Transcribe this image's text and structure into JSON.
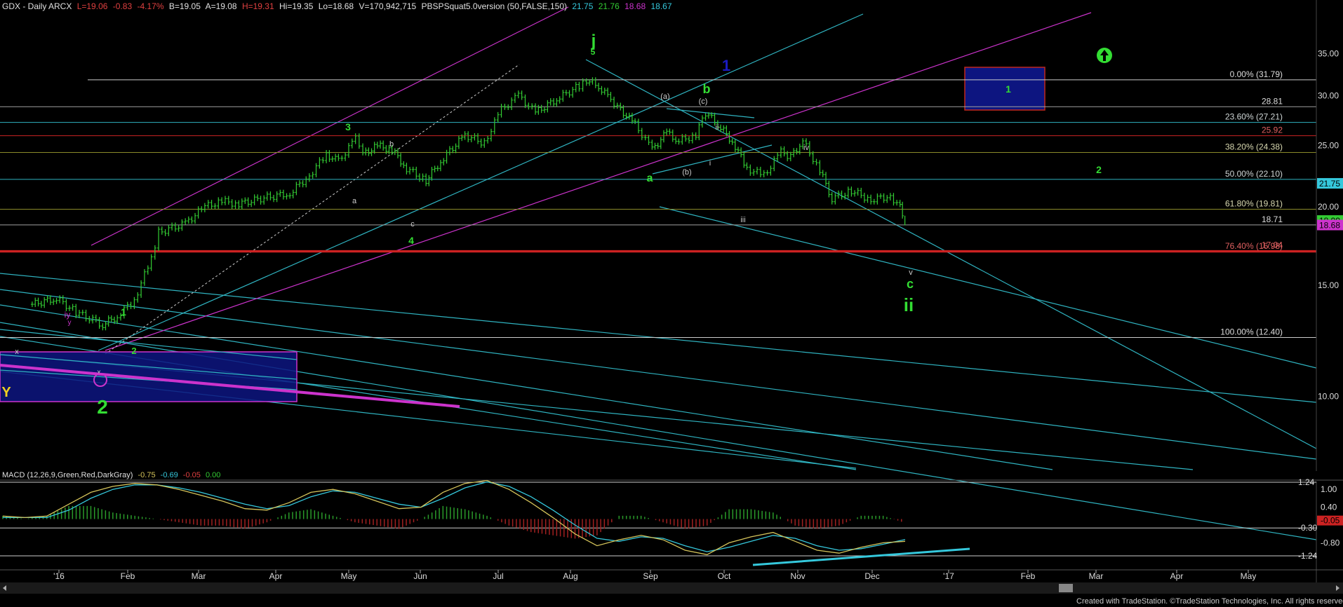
{
  "header": {
    "symbol": "GDX - Daily  ARCX",
    "last": "L=19.06",
    "change": "-0.83",
    "pct": "-4.17%",
    "bid": "B=19.05",
    "ask": "A=19.08",
    "hi": "H=19.31",
    "hi2": "Hi=19.35",
    "lo": "Lo=18.68",
    "vol": "V=170,942,715",
    "study": "PBSPSquat5.0version (50,FALSE,150)",
    "s1": "21.75",
    "s2": "21.76",
    "s3": "18.68",
    "s4": "18.67"
  },
  "macd_header": {
    "name": "MACD (12,26,9,Green,Red,DarkGray)",
    "v1": "-0.75",
    "v2": "-0.69",
    "v3": "-0.05",
    "v4": "0.00"
  },
  "footer": "Created with TradeStation. ©TradeStation Technologies, Inc. All rights reserved.",
  "colors": {
    "background": "#000000",
    "bars": "#33cc33",
    "cyan": "#2fb3c0",
    "magenta": "#cc33cc",
    "red": "#cc2222",
    "olive": "#8a8a2a",
    "box_fill": "#0d1580",
    "box_edge": "#c0281e",
    "wave_green": "#33dd33",
    "macd_yellow": "#d4c35a",
    "macd_cyan": "#35c8dc"
  },
  "chart_data": {
    "type": "line",
    "title": "GDX - Daily",
    "price_axis": {
      "ticks": [
        10.0,
        15.0,
        20.0,
        25.0,
        30.0,
        35.0
      ],
      "tick_labels": [
        "10.00",
        "15.00",
        "20.00",
        "25.00",
        "30.00",
        "35.00"
      ],
      "scale": "log"
    },
    "x_axis_labels": [
      "'16",
      "Feb",
      "Mar",
      "Apr",
      "May",
      "Jun",
      "Jul",
      "Aug",
      "Sep",
      "Oct",
      "Nov",
      "Dec",
      "'17",
      "Feb",
      "Mar",
      "Apr",
      "May"
    ],
    "price_markers": [
      {
        "label": "21.75",
        "value": 21.75,
        "color": "#35c8dc"
      },
      {
        "label": "18.99",
        "value": 18.99,
        "color": "#33cc33"
      },
      {
        "label": "18.68",
        "value": 18.68,
        "color": "#cc33cc"
      }
    ],
    "fib_levels": [
      {
        "label": "0.00% (31.79)",
        "value": 31.79,
        "color": "#cccccc"
      },
      {
        "label": "28.81",
        "value": 28.81,
        "color": "#a0a0a0"
      },
      {
        "label": "23.60% (27.21)",
        "value": 27.21,
        "color": "#2fb3c0"
      },
      {
        "label": "25.92",
        "value": 25.92,
        "color": "#cc2222"
      },
      {
        "label": "38.20% (24.38)",
        "value": 24.38,
        "color": "#8a8a2a"
      },
      {
        "label": "50.00% (22.10)",
        "value": 22.1,
        "color": "#2fb3c0"
      },
      {
        "label": "61.80% (19.81)",
        "value": 19.81,
        "color": "#8a8a2a"
      },
      {
        "label": "18.71",
        "value": 18.71,
        "color": "#a0a0a0"
      },
      {
        "label": "17.04",
        "value": 17.04,
        "color": "#cc2222"
      },
      {
        "label": "76.40% (16.98)",
        "value": 16.98,
        "color": "#cc2222"
      },
      {
        "label": "100.00% (12.40)",
        "value": 12.4,
        "color": "#cccccc"
      }
    ],
    "series": [
      {
        "name": "GDX",
        "dates": [
          "2015-12-21",
          "2015-12-31",
          "2016-01-08",
          "2016-01-19",
          "2016-01-25",
          "2016-02-01",
          "2016-02-08",
          "2016-02-11",
          "2016-02-22",
          "2016-03-01",
          "2016-03-08",
          "2016-03-15",
          "2016-03-24",
          "2016-04-05",
          "2016-04-13",
          "2016-04-20",
          "2016-04-25",
          "2016-05-02",
          "2016-05-05",
          "2016-05-11",
          "2016-05-17",
          "2016-05-23",
          "2016-05-31",
          "2016-06-06",
          "2016-06-16",
          "2016-06-24",
          "2016-07-01",
          "2016-07-08",
          "2016-07-15",
          "2016-07-25",
          "2016-08-02",
          "2016-08-05",
          "2016-08-10",
          "2016-08-15",
          "2016-08-19",
          "2016-08-25",
          "2016-09-01",
          "2016-09-07",
          "2016-09-12",
          "2016-09-19",
          "2016-09-23",
          "2016-09-28",
          "2016-10-04",
          "2016-10-10",
          "2016-10-17",
          "2016-10-24",
          "2016-10-28",
          "2016-11-02",
          "2016-11-09",
          "2016-11-14",
          "2016-11-22",
          "2016-11-30",
          "2016-12-08",
          "2016-12-12",
          "2016-12-14"
        ],
        "values": [
          14.0,
          14.3,
          13.6,
          13.0,
          13.4,
          14.2,
          16.5,
          18.2,
          18.8,
          20.0,
          20.4,
          20.2,
          20.6,
          21.0,
          22.4,
          24.2,
          23.6,
          25.6,
          24.2,
          25.0,
          24.6,
          23.0,
          22.0,
          23.6,
          26.0,
          25.2,
          28.5,
          30.0,
          28.2,
          29.8,
          31.1,
          31.79,
          31.0,
          29.6,
          28.5,
          27.0,
          24.6,
          26.2,
          25.4,
          26.0,
          28.2,
          27.0,
          25.4,
          23.0,
          22.4,
          24.4,
          24.0,
          25.4,
          22.8,
          20.6,
          21.2,
          20.5,
          20.8,
          20.0,
          19.06
        ]
      }
    ],
    "wave_labels": [
      "j",
      "5",
      "1",
      "2",
      "3",
      "4",
      "b",
      "b",
      "a",
      "c",
      "iy",
      "y",
      "x",
      "x",
      "Y",
      "(a)",
      "(b)",
      "(c)",
      "a",
      "b",
      "i",
      "ii",
      "iii",
      "iv",
      "v",
      "c",
      "ii",
      "1",
      "2",
      "1"
    ],
    "macd": {
      "labels": [
        "1.24",
        "1.00",
        "0.40",
        "-0.05",
        "-0.30",
        "-0.80",
        "-1.24"
      ],
      "macd_line": [
        0.1,
        0.05,
        0.1,
        0.5,
        0.9,
        1.1,
        1.2,
        1.15,
        1.0,
        0.8,
        0.6,
        0.35,
        0.3,
        0.55,
        0.9,
        1.0,
        0.85,
        0.6,
        0.35,
        0.4,
        0.9,
        1.2,
        1.3,
        1.0,
        0.55,
        0.05,
        -0.5,
        -0.9,
        -0.7,
        -0.55,
        -0.7,
        -1.05,
        -1.2,
        -0.8,
        -0.6,
        -0.45,
        -0.75,
        -1.05,
        -1.15,
        -0.95,
        -0.8,
        -0.75
      ],
      "signal_line": [
        0.05,
        0.05,
        0.05,
        0.3,
        0.7,
        1.0,
        1.15,
        1.15,
        1.05,
        0.9,
        0.7,
        0.5,
        0.35,
        0.45,
        0.75,
        0.95,
        0.9,
        0.7,
        0.5,
        0.4,
        0.7,
        1.05,
        1.25,
        1.1,
        0.75,
        0.3,
        -0.2,
        -0.65,
        -0.75,
        -0.6,
        -0.65,
        -0.9,
        -1.1,
        -0.95,
        -0.75,
        -0.55,
        -0.65,
        -0.9,
        -1.05,
        -1.0,
        -0.85,
        -0.69
      ]
    }
  }
}
